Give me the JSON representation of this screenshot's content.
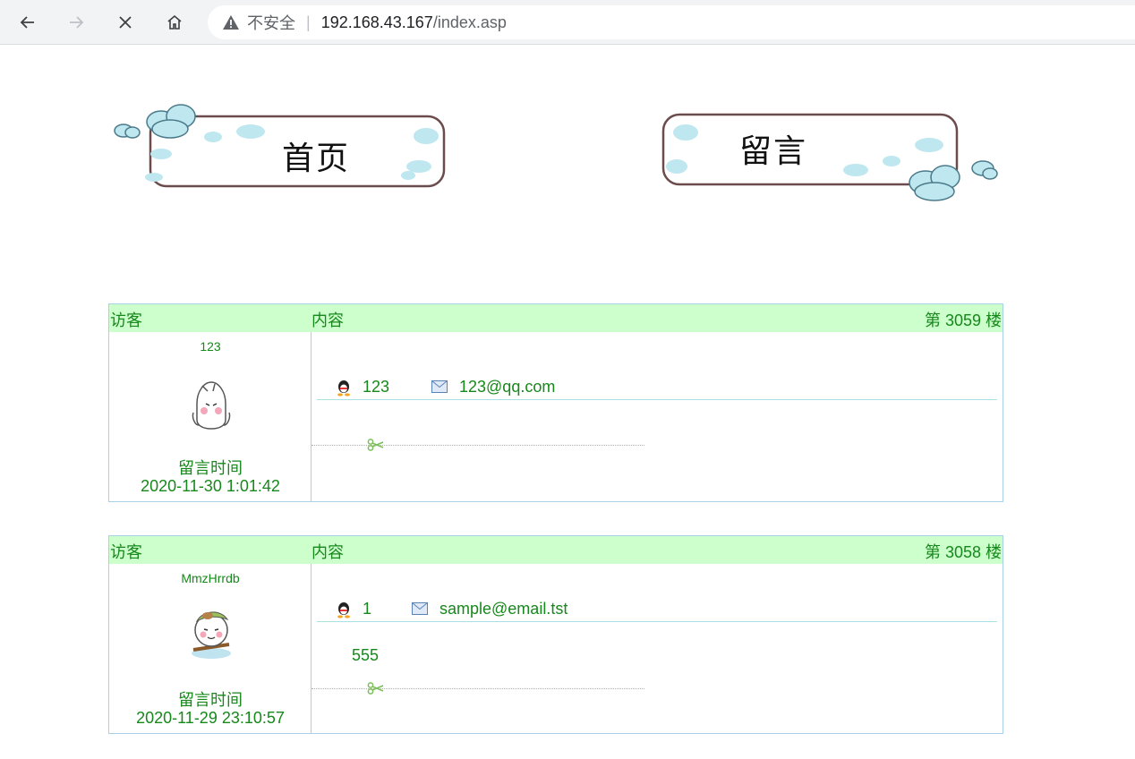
{
  "browser": {
    "insecure_label": "不安全",
    "separator": "|",
    "url_host": "192.168.43.167",
    "url_path": "/index.asp"
  },
  "banners": {
    "home_label": "首页",
    "guestbook_label": "留言"
  },
  "header": {
    "visitor": "访客",
    "content": "内容"
  },
  "posts": [
    {
      "floor_text": "第 3059 楼",
      "visitor": "123",
      "qq": "123",
      "email": "123@qq.com",
      "content": "",
      "time_label": "留言时间",
      "time": "2020-11-30 1:01:42"
    },
    {
      "floor_text": "第 3058 楼",
      "visitor": "MmzHrrdb",
      "qq": "1",
      "email": "sample@email.tst",
      "content": "555",
      "time_label": "留言时间",
      "time": "2020-11-29 23:10:57"
    }
  ],
  "colors": {
    "text_green": "#17881b",
    "header_bg": "#ccffcc",
    "border": "#a8d0e6"
  }
}
